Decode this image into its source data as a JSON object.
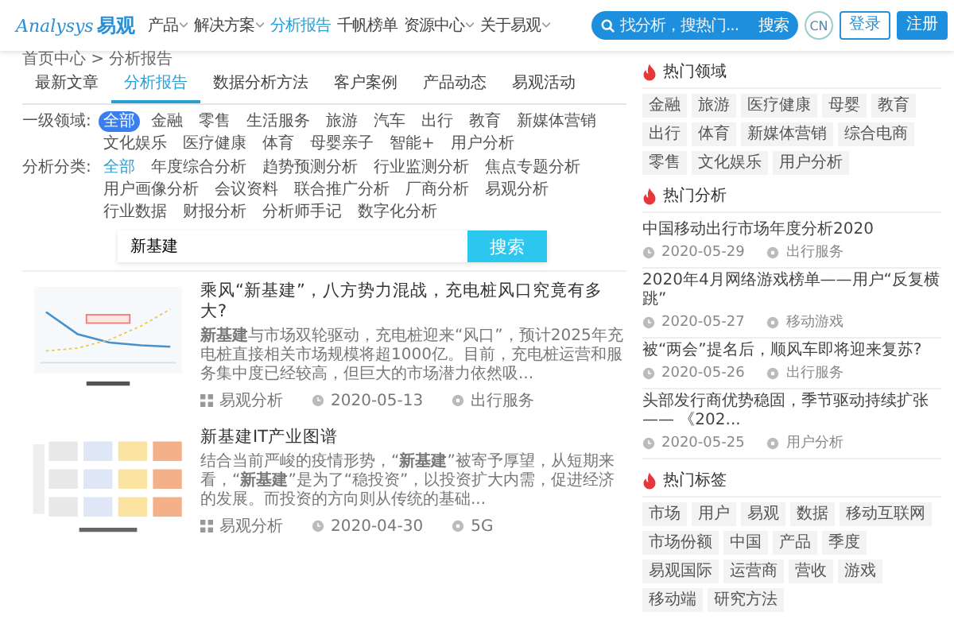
{
  "header": {
    "logo": {
      "latin": "Analysys",
      "cjk": "易观"
    },
    "nav": [
      {
        "label": "产品",
        "dropdown": true,
        "selected": false
      },
      {
        "label": "解决方案",
        "dropdown": true,
        "selected": false
      },
      {
        "label": "分析报告",
        "dropdown": false,
        "selected": true
      },
      {
        "label": "千帆榜单",
        "dropdown": false,
        "selected": false
      },
      {
        "label": "资源中心",
        "dropdown": true,
        "selected": false
      },
      {
        "label": "关于易观",
        "dropdown": true,
        "selected": false
      }
    ],
    "search": {
      "placeholder": "找分析，搜热门...",
      "button": "搜索"
    },
    "language": "CN",
    "login": "登录",
    "register": "注册"
  },
  "breadcrumb": "首页中心 > 分析报告",
  "tabs": [
    {
      "label": "最新文章",
      "selected": false
    },
    {
      "label": "分析报告",
      "selected": true
    },
    {
      "label": "数据分析方法",
      "selected": false
    },
    {
      "label": "客户案例",
      "selected": false
    },
    {
      "label": "产品动态",
      "selected": false
    },
    {
      "label": "易观活动",
      "selected": false
    }
  ],
  "filters": [
    {
      "label": "一级领域:",
      "options": [
        {
          "label": "全部",
          "selected": true
        },
        {
          "label": "金融",
          "selected": false
        },
        {
          "label": "零售",
          "selected": false
        },
        {
          "label": "生活服务",
          "selected": false
        },
        {
          "label": "旅游",
          "selected": false
        },
        {
          "label": "汽车",
          "selected": false
        },
        {
          "label": "出行",
          "selected": false
        },
        {
          "label": "教育",
          "selected": false
        },
        {
          "label": "新媒体营销",
          "selected": false
        },
        {
          "label": "文化娱乐",
          "selected": false
        },
        {
          "label": "医疗健康",
          "selected": false
        },
        {
          "label": "体育",
          "selected": false
        },
        {
          "label": "母婴亲子",
          "selected": false
        },
        {
          "label": "智能+",
          "selected": false
        },
        {
          "label": "用户分析",
          "selected": false
        }
      ]
    },
    {
      "label": "分析分类:",
      "options": [
        {
          "label": "全部",
          "selected": true
        },
        {
          "label": "年度综合分析",
          "selected": false
        },
        {
          "label": "趋势预测分析",
          "selected": false
        },
        {
          "label": "行业监测分析",
          "selected": false
        },
        {
          "label": "焦点专题分析",
          "selected": false
        },
        {
          "label": "用户画像分析",
          "selected": false
        },
        {
          "label": "会议资料",
          "selected": false
        },
        {
          "label": "联合推广分析",
          "selected": false
        },
        {
          "label": "厂商分析",
          "selected": false
        },
        {
          "label": "易观分析",
          "selected": false
        },
        {
          "label": "行业数据",
          "selected": false
        },
        {
          "label": "财报分析",
          "selected": false
        },
        {
          "label": "分析师手记",
          "selected": false
        },
        {
          "label": "数字化分析",
          "selected": false
        }
      ]
    }
  ],
  "search": {
    "value": "新基建",
    "button": "搜索"
  },
  "articles": [
    {
      "kind": "chart",
      "title": "乘风“新基建”，八方势力混战，充电桩风口究竟有多大?",
      "summary": "**新基建**与市场双轮驱动，充电桩迎来“风口”，预计2025年充电桩直接相关市场规模将超1000亿。目前，充电桩运营和服务集中度已经较高，但巨大的市场潜力依然吸...",
      "source": "易观分析",
      "date": "2020-05-13",
      "tag": "出行服务"
    },
    {
      "kind": "map",
      "title": "新基建IT产业图谱",
      "summary": "结合当前严峻的疫情形势，“**新基建**”被寄予厚望，从短期来看，“**新基建**”是为了“稳投资”，以投资扩大内需，促进经济的发展。而投资的方向则从传统的基础...",
      "source": "易观分析",
      "date": "2020-04-30",
      "tag": "5G"
    }
  ],
  "sidebar": {
    "hot_fields": {
      "title": "热门领域",
      "tags": [
        "金融",
        "旅游",
        "医疗健康",
        "母婴",
        "教育",
        "出行",
        "体育",
        "新媒体营销",
        "综合电商",
        "零售",
        "文化娱乐",
        "用户分析"
      ]
    },
    "hot_analysis": {
      "title": "热门分析",
      "items": [
        {
          "title": "中国移动出行市场年度分析2020",
          "date": "2020-05-29",
          "tag": "出行服务"
        },
        {
          "title": "2020年4月网络游戏榜单——用户“反复横跳”",
          "date": "2020-05-27",
          "tag": "移动游戏"
        },
        {
          "title": "被“两会”提名后，顺风车即将迎来复苏?",
          "date": "2020-05-26",
          "tag": "出行服务"
        },
        {
          "title": "头部发行商优势稳固，季节驱动持续扩张 —— 《202...",
          "date": "2020-05-25",
          "tag": "用户分析"
        }
      ]
    },
    "hot_tags": {
      "title": "热门标签",
      "tags": [
        "市场",
        "用户",
        "易观",
        "数据",
        "移动互联网",
        "市场份额",
        "中国",
        "产品",
        "季度",
        "易观国际",
        "运营商",
        "营收",
        "游戏",
        "移动端",
        "研究方法"
      ]
    }
  }
}
